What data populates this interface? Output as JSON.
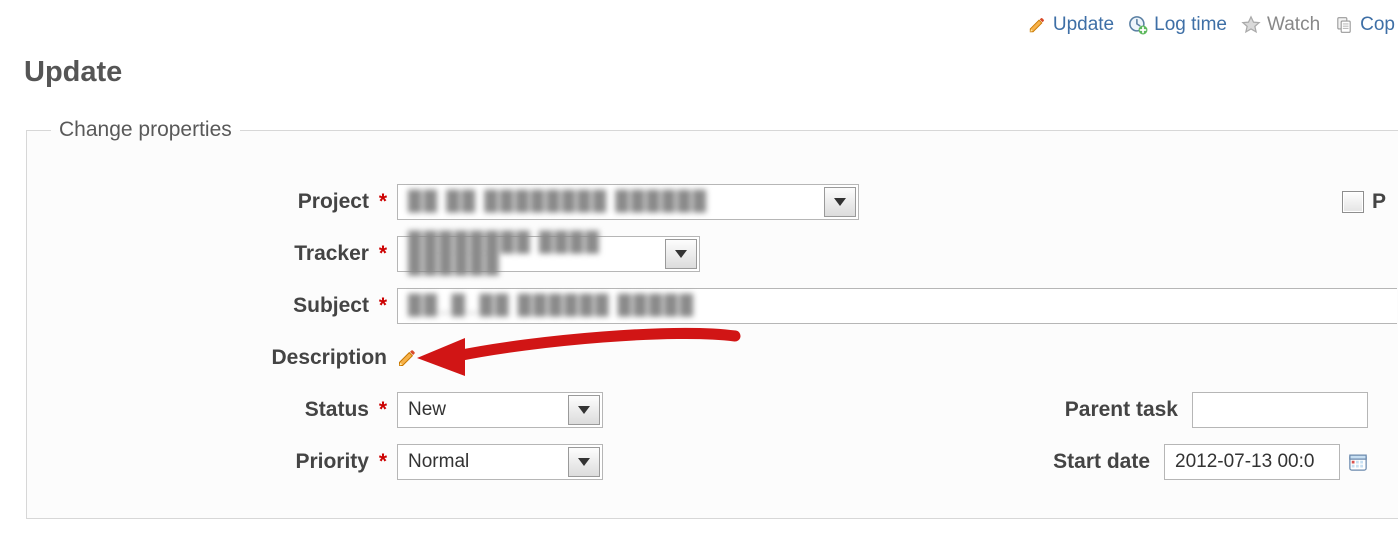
{
  "actions": {
    "update": "Update",
    "log_time": "Log time",
    "watch": "Watch",
    "copy": "Cop"
  },
  "page_title": "Update",
  "legend": "Change properties",
  "labels": {
    "project": "Project",
    "tracker": "Tracker",
    "subject": "Subject",
    "description": "Description",
    "status": "Status",
    "priority": "Priority",
    "parent_task": "Parent task",
    "start_date": "Start date",
    "private_fragment": "P"
  },
  "values": {
    "project": "██ ██ ████████ ██████",
    "tracker": "████████ ████ ██████",
    "subject": "██_█_██ ██████ █████",
    "status": "New",
    "priority": "Normal",
    "parent_task": "",
    "start_date": "2012-07-13 00:0"
  },
  "required_marker": "*",
  "colors": {
    "link": "#3E6FA6",
    "required": "#c00",
    "arrow": "#d11515"
  }
}
